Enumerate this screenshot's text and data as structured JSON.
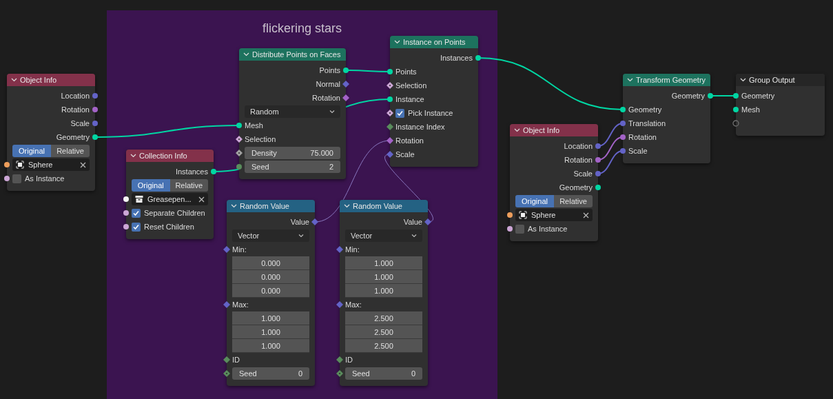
{
  "frame": {
    "title": "flickering stars"
  },
  "nodes": [
    {
      "title": "Object Info",
      "kind": "input",
      "rows": [
        {
          "kind": "output",
          "label": "Location",
          "socket": {
            "kind": "circle",
            "color": "#6363c7"
          }
        },
        {
          "kind": "output",
          "label": "Rotation",
          "socket": {
            "kind": "circle",
            "color": "#a363c7"
          }
        },
        {
          "kind": "output",
          "label": "Scale",
          "socket": {
            "kind": "circle",
            "color": "#6363c7"
          }
        },
        {
          "kind": "output",
          "label": "Geometry",
          "socket": {
            "kind": "circle",
            "color": "#00d6a3"
          }
        },
        {
          "kind": "toggle",
          "options": [
            {
              "label": "Original",
              "selected": true
            },
            {
              "label": "Relative",
              "selected": false
            }
          ]
        },
        {
          "kind": "object",
          "icon": {
            "kind": "object"
          },
          "value": "Sphere",
          "socket": {
            "kind": "circle",
            "color": "#ed9e5c"
          }
        },
        {
          "kind": "checkbox",
          "label": "As Instance",
          "checked": false,
          "socket": {
            "kind": "circle",
            "color": "#cca6d6"
          }
        }
      ]
    },
    {
      "title": "Collection Info",
      "kind": "input",
      "rows": [
        {
          "kind": "output",
          "label": "Instances",
          "socket": {
            "kind": "circle",
            "color": "#00d6a3"
          }
        },
        {
          "kind": "toggle",
          "options": [
            {
              "label": "Original",
              "selected": true
            },
            {
              "label": "Relative",
              "selected": false
            }
          ]
        },
        {
          "kind": "object",
          "icon": {
            "kind": "collection"
          },
          "value": "Greasepen...",
          "socket": {
            "kind": "circle",
            "color": "#f5f5f5"
          }
        },
        {
          "kind": "checkbox",
          "label": "Separate Children",
          "checked": true,
          "socket": {
            "kind": "circle",
            "color": "#cca6d6"
          }
        },
        {
          "kind": "checkbox",
          "label": "Reset Children",
          "checked": true,
          "socket": {
            "kind": "circle",
            "color": "#cca6d6"
          }
        }
      ]
    },
    {
      "title": "Distribute Points on Faces",
      "kind": "geometry",
      "rows": [
        {
          "kind": "output",
          "label": "Points",
          "socket": {
            "kind": "circle",
            "color": "#00d6a3"
          }
        },
        {
          "kind": "output",
          "label": "Normal",
          "socket": {
            "kind": "diamond",
            "color": "#6363c7"
          }
        },
        {
          "kind": "output",
          "label": "Rotation",
          "socket": {
            "kind": "diamond",
            "color": "#a363c7"
          }
        },
        {
          "kind": "menu",
          "value": "Random"
        },
        {
          "kind": "input",
          "label": "Mesh",
          "socket": {
            "kind": "circle",
            "color": "#00d6a3"
          }
        },
        {
          "kind": "input",
          "label": "Selection",
          "socket": {
            "kind": "diamond_dot",
            "color": "#cca6d6"
          }
        },
        {
          "kind": "slider",
          "label": "Density",
          "value": "75.000",
          "socket": {
            "kind": "diamond_dot",
            "color": "#a1a1a1"
          }
        },
        {
          "kind": "slider",
          "label": "Seed",
          "value": "2",
          "socket": {
            "kind": "circle",
            "color": "#598c5c"
          }
        }
      ]
    },
    {
      "title": "Instance on Points",
      "kind": "geometry",
      "rows": [
        {
          "kind": "output",
          "label": "Instances",
          "socket": {
            "kind": "circle",
            "color": "#00d6a3"
          }
        },
        {
          "kind": "input",
          "label": "Points",
          "socket": {
            "kind": "circle",
            "color": "#00d6a3"
          }
        },
        {
          "kind": "input",
          "label": "Selection",
          "socket": {
            "kind": "diamond_dot",
            "color": "#cca6d6"
          }
        },
        {
          "kind": "input",
          "label": "Instance",
          "socket": {
            "kind": "circle",
            "color": "#00d6a3"
          }
        },
        {
          "kind": "checkbox",
          "label": "Pick Instance",
          "checked": true,
          "socket": {
            "kind": "diamond_dot",
            "color": "#cca6d6"
          }
        },
        {
          "kind": "input",
          "label": "Instance Index",
          "socket": {
            "kind": "diamond",
            "color": "#598c5c"
          }
        },
        {
          "kind": "input",
          "label": "Rotation",
          "socket": {
            "kind": "diamond",
            "color": "#a363c7"
          }
        },
        {
          "kind": "input",
          "label": "Scale",
          "socket": {
            "kind": "diamond",
            "color": "#6363c7"
          }
        }
      ]
    },
    {
      "title": "Random Value",
      "kind": "converter",
      "rows": [
        {
          "kind": "output",
          "label": "Value",
          "socket": {
            "kind": "diamond",
            "color": "#6363c7"
          }
        },
        {
          "kind": "menu",
          "value": "Vector"
        },
        {
          "kind": "input",
          "label": "Min:",
          "socket": {
            "kind": "diamond",
            "color": "#6363c7"
          }
        },
        {
          "kind": "number",
          "value": "0.000"
        },
        {
          "kind": "number",
          "value": "0.000"
        },
        {
          "kind": "number",
          "value": "0.000"
        },
        {
          "kind": "input",
          "label": "Max:",
          "socket": {
            "kind": "diamond",
            "color": "#6363c7"
          }
        },
        {
          "kind": "number",
          "value": "1.000"
        },
        {
          "kind": "number",
          "value": "1.000"
        },
        {
          "kind": "number",
          "value": "1.000"
        },
        {
          "kind": "input",
          "label": "ID",
          "socket": {
            "kind": "diamond",
            "color": "#598c5c"
          }
        },
        {
          "kind": "slider",
          "label": "Seed",
          "value": "0",
          "socket": {
            "kind": "diamond_dot",
            "color": "#598c5c"
          }
        }
      ]
    },
    {
      "title": "Random Value",
      "kind": "converter",
      "rows": [
        {
          "kind": "output",
          "label": "Value",
          "socket": {
            "kind": "diamond",
            "color": "#6363c7"
          }
        },
        {
          "kind": "menu",
          "value": "Vector"
        },
        {
          "kind": "input",
          "label": "Min:",
          "socket": {
            "kind": "diamond",
            "color": "#6363c7"
          }
        },
        {
          "kind": "number",
          "value": "1.000"
        },
        {
          "kind": "number",
          "value": "1.000"
        },
        {
          "kind": "number",
          "value": "1.000"
        },
        {
          "kind": "input",
          "label": "Max:",
          "socket": {
            "kind": "diamond",
            "color": "#6363c7"
          }
        },
        {
          "kind": "number",
          "value": "2.500"
        },
        {
          "kind": "number",
          "value": "2.500"
        },
        {
          "kind": "number",
          "value": "2.500"
        },
        {
          "kind": "input",
          "label": "ID",
          "socket": {
            "kind": "diamond",
            "color": "#598c5c"
          }
        },
        {
          "kind": "slider",
          "label": "Seed",
          "value": "0",
          "socket": {
            "kind": "diamond_dot",
            "color": "#598c5c"
          }
        }
      ]
    },
    {
      "title": "Object Info",
      "kind": "input",
      "rows": [
        {
          "kind": "output",
          "label": "Location",
          "socket": {
            "kind": "circle",
            "color": "#6363c7"
          }
        },
        {
          "kind": "output",
          "label": "Rotation",
          "socket": {
            "kind": "circle",
            "color": "#a363c7"
          }
        },
        {
          "kind": "output",
          "label": "Scale",
          "socket": {
            "kind": "circle",
            "color": "#6363c7"
          }
        },
        {
          "kind": "output",
          "label": "Geometry",
          "socket": {
            "kind": "circle",
            "color": "#00d6a3"
          }
        },
        {
          "kind": "toggle",
          "options": [
            {
              "label": "Original",
              "selected": true
            },
            {
              "label": "Relative",
              "selected": false
            }
          ]
        },
        {
          "kind": "object",
          "icon": {
            "kind": "object"
          },
          "value": "Sphere",
          "socket": {
            "kind": "circle",
            "color": "#ed9e5c"
          }
        },
        {
          "kind": "checkbox",
          "label": "As Instance",
          "checked": false,
          "socket": {
            "kind": "circle",
            "color": "#cca6d6"
          }
        }
      ]
    },
    {
      "title": "Transform Geometry",
      "kind": "geometry",
      "rows": [
        {
          "kind": "output",
          "label": "Geometry",
          "socket": {
            "kind": "circle",
            "color": "#00d6a3"
          }
        },
        {
          "kind": "input",
          "label": "Geometry",
          "socket": {
            "kind": "circle",
            "color": "#00d6a3"
          }
        },
        {
          "kind": "input",
          "label": "Translation",
          "socket": {
            "kind": "circle",
            "color": "#6363c7"
          }
        },
        {
          "kind": "input",
          "label": "Rotation",
          "socket": {
            "kind": "circle",
            "color": "#a363c7"
          }
        },
        {
          "kind": "input",
          "label": "Scale",
          "socket": {
            "kind": "circle",
            "color": "#6363c7"
          }
        }
      ]
    },
    {
      "title": "Group Output",
      "kind": "output",
      "rows": [
        {
          "kind": "input",
          "label": "Geometry",
          "socket": {
            "kind": "circle",
            "color": "#00d6a3"
          }
        },
        {
          "kind": "input",
          "label": "Mesh",
          "socket": {
            "kind": "circle",
            "color": "#00d6a3"
          }
        },
        {
          "kind": "socket",
          "socket": {
            "kind": "hollow",
            "color": "#6e6e6e"
          }
        }
      ]
    }
  ]
}
